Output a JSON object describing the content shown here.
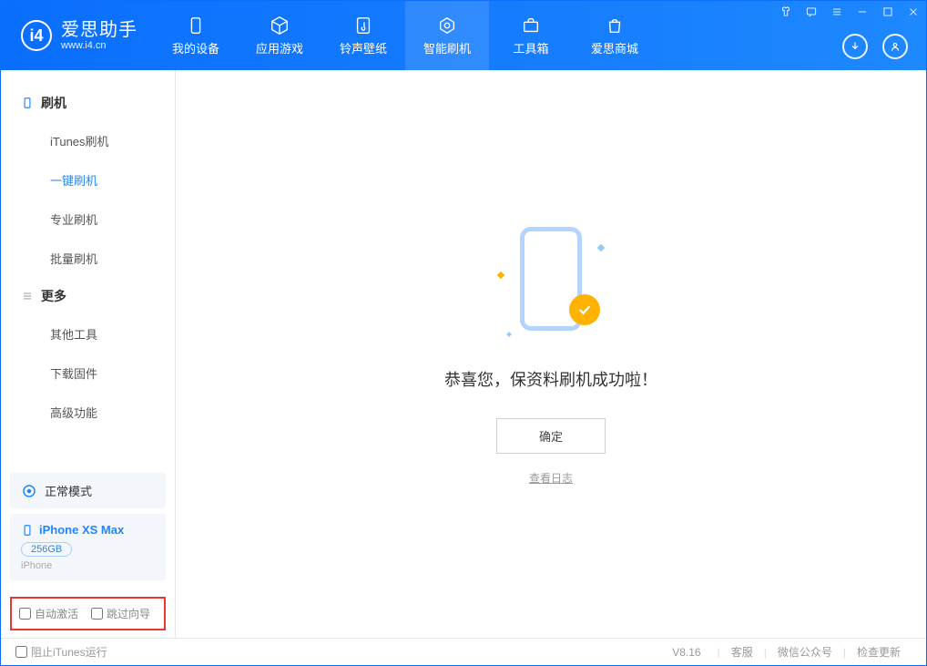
{
  "header": {
    "logo_title": "爱思助手",
    "logo_sub": "www.i4.cn",
    "nav": [
      {
        "label": "我的设备",
        "icon": "device"
      },
      {
        "label": "应用游戏",
        "icon": "cube"
      },
      {
        "label": "铃声壁纸",
        "icon": "music"
      },
      {
        "label": "智能刷机",
        "icon": "refresh",
        "active": true
      },
      {
        "label": "工具箱",
        "icon": "toolbox"
      },
      {
        "label": "爱思商城",
        "icon": "store"
      }
    ]
  },
  "sidebar": {
    "section1": {
      "title": "刷机",
      "items": [
        "iTunes刷机",
        "一键刷机",
        "专业刷机",
        "批量刷机"
      ],
      "active_index": 1
    },
    "section2": {
      "title": "更多",
      "items": [
        "其他工具",
        "下载固件",
        "高级功能"
      ]
    },
    "mode_label": "正常模式",
    "device": {
      "name": "iPhone XS Max",
      "capacity": "256GB",
      "type": "iPhone"
    },
    "opt_auto_activate": "自动激活",
    "opt_skip_guide": "跳过向导"
  },
  "content": {
    "result_text": "恭喜您，保资料刷机成功啦！",
    "ok_label": "确定",
    "log_link": "查看日志"
  },
  "footer": {
    "block_itunes": "阻止iTunes运行",
    "version": "V8.16",
    "links": [
      "客服",
      "微信公众号",
      "检查更新"
    ]
  }
}
